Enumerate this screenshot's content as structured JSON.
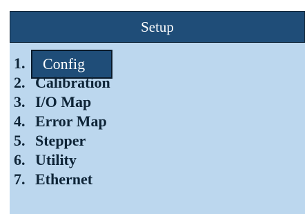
{
  "header": {
    "title": "Setup"
  },
  "menu": {
    "selected_index": 0,
    "items": [
      {
        "num": "1.",
        "label": "Config"
      },
      {
        "num": "2.",
        "label": "Calibration"
      },
      {
        "num": "3.",
        "label": "I/O Map"
      },
      {
        "num": "4.",
        "label": "Error Map"
      },
      {
        "num": "5.",
        "label": "Stepper"
      },
      {
        "num": "6.",
        "label": "Utility"
      },
      {
        "num": "7.",
        "label": "Ethernet"
      }
    ]
  },
  "colors": {
    "background": "#bcd7ee",
    "header": "#1f4d78",
    "selection": "#1f4d78",
    "text": "#0e2437"
  }
}
